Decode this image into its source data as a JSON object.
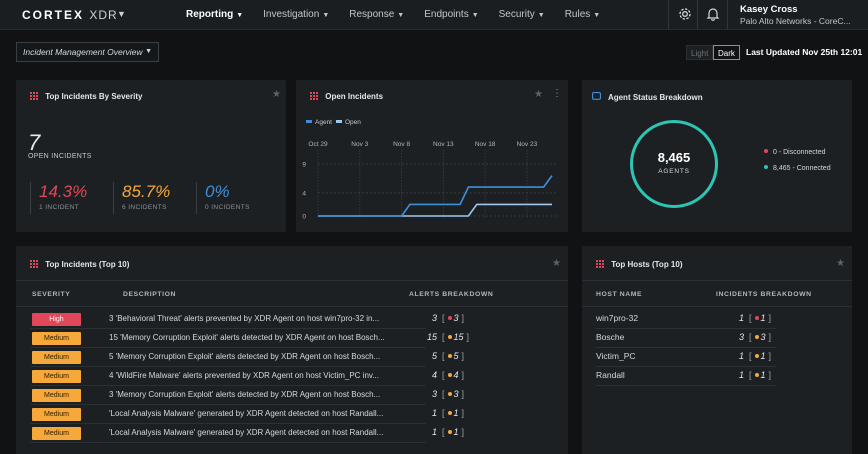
{
  "nav": {
    "logo": "CORTEX",
    "logo_product": "XDR",
    "items": [
      {
        "label": "Reporting",
        "active": true
      },
      {
        "label": "Investigation",
        "active": false
      },
      {
        "label": "Response",
        "active": false
      },
      {
        "label": "Endpoints",
        "active": false
      },
      {
        "label": "Security",
        "active": false
      },
      {
        "label": "Rules",
        "active": false
      }
    ],
    "icons": [
      "gear-icon",
      "bell-icon"
    ],
    "user_name": "Kasey Cross",
    "user_org": "Palo Alto Networks - CoreC..."
  },
  "toolbar": {
    "dashboard": "Incident Management Overview",
    "theme_light": "Light",
    "theme_dark": "Dark",
    "last_updated": "Last Updated Nov 25th 12:01"
  },
  "severity_panel": {
    "title": "Top Incidents By Severity",
    "total": "7",
    "total_label": "OPEN INCIDENTS",
    "blocks": [
      {
        "pct": "14.3%",
        "sub": "1 INCIDENT",
        "color": "#e0485a"
      },
      {
        "pct": "85.7%",
        "sub": "6 INCIDENTS",
        "color": "#f6a93a"
      },
      {
        "pct": "0%",
        "sub": "0 INCIDENTS",
        "color": "#3f8fd8"
      }
    ]
  },
  "open_incidents": {
    "title": "Open Incidents",
    "chart_data": {
      "type": "line",
      "x_ticks": [
        "Oct 29",
        "Nov 3",
        "Nov 8",
        "Nov 13",
        "Nov 18",
        "Nov 23"
      ],
      "y_ticks": [
        "0",
        "4",
        "9"
      ],
      "ylim": [
        0,
        9
      ],
      "legend_position": "top-left",
      "grid": true,
      "series": [
        {
          "name": "Agent",
          "color": "#3f8fd8",
          "x": [
            "Oct 29",
            "Nov 8",
            "Nov 9",
            "Nov 15",
            "Nov 16",
            "Nov 25",
            "Nov 26"
          ],
          "values": [
            0,
            0,
            2,
            2,
            5,
            5,
            7
          ]
        },
        {
          "name": "Open",
          "color": "#9ec8ef",
          "x": [
            "Oct 29",
            "Nov 16",
            "Nov 17",
            "Nov 26"
          ],
          "values": [
            0,
            0,
            2,
            2
          ]
        }
      ]
    }
  },
  "agent_status": {
    "title": "Agent Status Breakdown",
    "total": "8,465",
    "total_label": "AGENTS",
    "legend": [
      {
        "label": "0 - Disconnected",
        "color": "#e0485a"
      },
      {
        "label": "8,465 - Connected",
        "color": "#2dc5b3"
      }
    ],
    "ring_color": "#2dc5b3"
  },
  "top_incidents": {
    "title": "Top Incidents (Top 10)",
    "columns": [
      "SEVERITY",
      "DESCRIPTION",
      "ALERTS BREAKDOWN"
    ],
    "rows": [
      {
        "severity": "High",
        "level": "high",
        "description": "3 'Behavioral Threat' alerts prevented by XDR Agent on host win7pro-32 in...",
        "count": "3",
        "bracket_open": "[",
        "sub": "3",
        "bracket_close": "]",
        "dot": "#e0485a"
      },
      {
        "severity": "Medium",
        "level": "medium",
        "description": "15 'Memory Corruption Exploit' alerts detected by XDR Agent on host Bosch...",
        "count": "15",
        "bracket_open": "[",
        "sub": "15",
        "bracket_close": "]",
        "dot": "#f6a93a"
      },
      {
        "severity": "Medium",
        "level": "medium",
        "description": "5 'Memory Corruption Exploit' alerts detected by XDR Agent on host Bosch...",
        "count": "5",
        "bracket_open": "[",
        "sub": "5",
        "bracket_close": "]",
        "dot": "#f6a93a"
      },
      {
        "severity": "Medium",
        "level": "medium",
        "description": "4 'WildFire Malware' alerts prevented by XDR Agent on host Victim_PC inv...",
        "count": "4",
        "bracket_open": "[",
        "sub": "4",
        "bracket_close": "]",
        "dot": "#f6a93a"
      },
      {
        "severity": "Medium",
        "level": "medium",
        "description": "3 'Memory Corruption Exploit' alerts detected by XDR Agent on host Bosch...",
        "count": "3",
        "bracket_open": "[",
        "sub": "3",
        "bracket_close": "]",
        "dot": "#f6a93a"
      },
      {
        "severity": "Medium",
        "level": "medium",
        "description": "'Local Analysis Malware' generated by XDR Agent detected on host Randall...",
        "count": "1",
        "bracket_open": "[",
        "sub": "1",
        "bracket_close": "]",
        "dot": "#f6a93a"
      },
      {
        "severity": "Medium",
        "level": "medium",
        "description": "'Local Analysis Malware' generated by XDR Agent detected on host Randall...",
        "count": "1",
        "bracket_open": "[",
        "sub": "1",
        "bracket_close": "]",
        "dot": "#f6a93a"
      }
    ]
  },
  "top_hosts": {
    "title": "Top Hosts (Top 10)",
    "columns": [
      "HOST NAME",
      "INCIDENTS BREAKDOWN"
    ],
    "rows": [
      {
        "host": "win7pro-32",
        "count": "1",
        "bracket_open": "[",
        "sub": "1",
        "bracket_close": "]",
        "dot": "#e0485a"
      },
      {
        "host": "Bosche",
        "count": "3",
        "bracket_open": "[",
        "sub": "3",
        "bracket_close": "]",
        "dot": "#f6a93a"
      },
      {
        "host": "Victim_PC",
        "count": "1",
        "bracket_open": "[",
        "sub": "1",
        "bracket_close": "]",
        "dot": "#f6a93a"
      },
      {
        "host": "Randall",
        "count": "1",
        "bracket_open": "[",
        "sub": "1",
        "bracket_close": "]",
        "dot": "#f6a93a"
      }
    ]
  }
}
